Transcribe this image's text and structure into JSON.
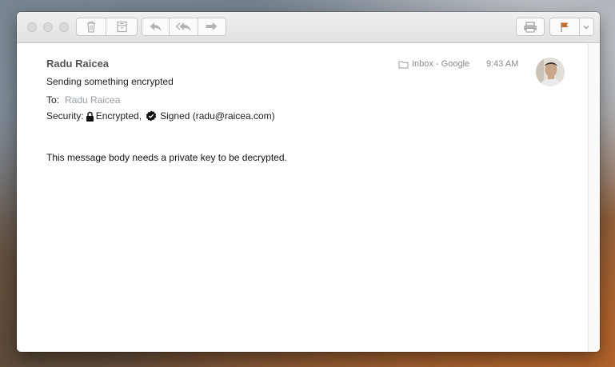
{
  "toolbar": {
    "window_controls": [
      "close",
      "minimize",
      "zoom"
    ],
    "buttons": [
      {
        "icon": "trash-icon"
      },
      {
        "icon": "archive-icon"
      },
      {
        "icon": "reply-icon"
      },
      {
        "icon": "reply-all-icon"
      },
      {
        "icon": "forward-icon"
      },
      {
        "icon": "print-icon"
      },
      {
        "icon": "flag-icon"
      },
      {
        "icon": "chevron-down-icon"
      }
    ],
    "flag_color": "#c96a2a"
  },
  "message": {
    "sender": "Radu Raicea",
    "subject": "Sending something encrypted",
    "to_label": "To:",
    "to_name": "Radu Raicea",
    "security_label": "Security:",
    "encrypted_label": "Encrypted,",
    "signed_label": "Signed (radu@raicea.com)",
    "mailbox": "Inbox - Google",
    "time": "9:43 AM",
    "body": "This message body needs a private key to be decrypted."
  }
}
